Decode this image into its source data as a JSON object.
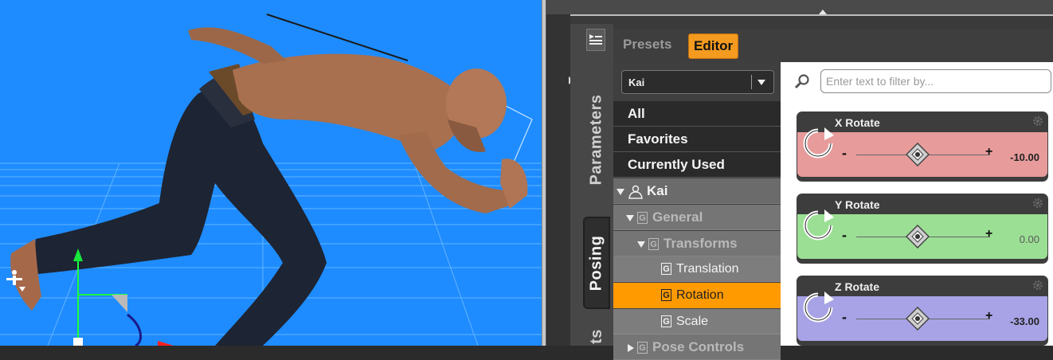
{
  "viewport": {
    "background": "#1e8cff"
  },
  "panel": {
    "side_tabs": [
      "Parameters",
      "Posing",
      "ts"
    ],
    "header_tabs": {
      "presets": "Presets",
      "editor": "Editor"
    }
  },
  "node_select": {
    "value": "Kai"
  },
  "tree": {
    "items": [
      {
        "label": "All"
      },
      {
        "label": "Favorites"
      },
      {
        "label": "Currently Used"
      },
      {
        "label": "Kai",
        "icon": "figure-icon"
      },
      {
        "label": "General"
      },
      {
        "label": "Transforms"
      },
      {
        "label": "Translation"
      },
      {
        "label": "Rotation",
        "selected": true
      },
      {
        "label": "Scale"
      },
      {
        "label": "Pose Controls"
      }
    ]
  },
  "filter": {
    "placeholder": "Enter text to filter by..."
  },
  "sliders": [
    {
      "title": "X Rotate",
      "minus": "-",
      "plus": "+",
      "value": "-10.00",
      "color": "#e79b9b",
      "value_color": "#222222"
    },
    {
      "title": "Y Rotate",
      "minus": "-",
      "plus": "+",
      "value": "0.00",
      "color": "#9bdf94",
      "value_color": "#5a5a5a"
    },
    {
      "title": "Z Rotate",
      "minus": "-",
      "plus": "+",
      "value": "-33.00",
      "color": "#a8a3e6",
      "value_color": "#222222"
    }
  ],
  "colors": {
    "accent": "#f39a1f",
    "selection": "#ff9a00"
  }
}
